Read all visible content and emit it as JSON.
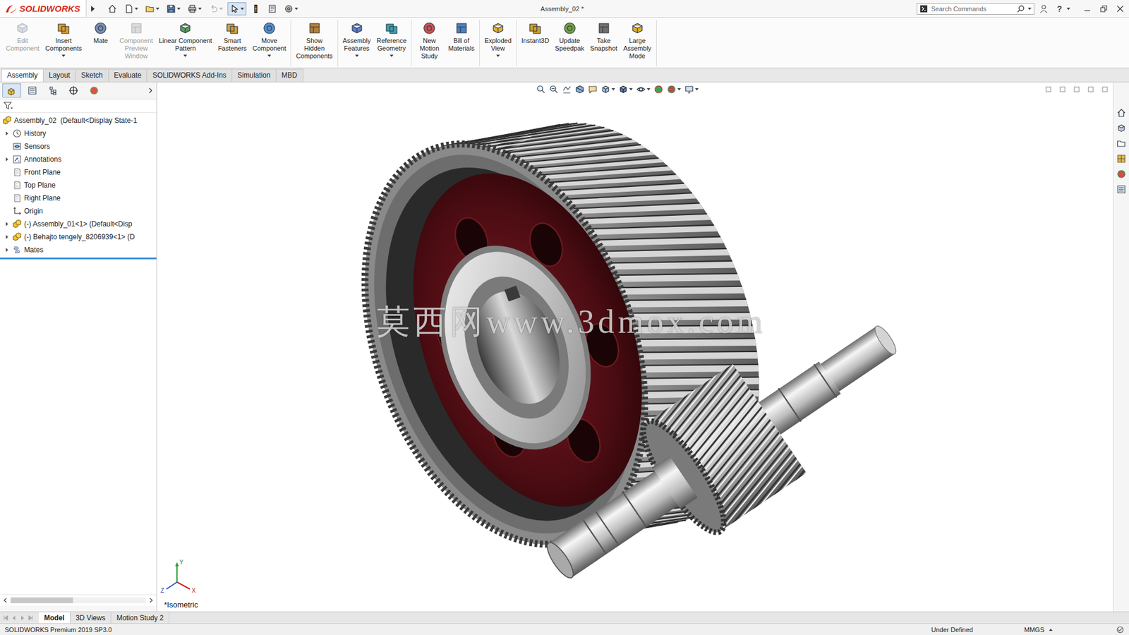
{
  "app": {
    "logo": "SOLIDWORKS",
    "title": "Assembly_02 *",
    "search_placeholder": "Search Commands",
    "help": "?"
  },
  "quick_access": [
    {
      "active": false,
      "disabled": false,
      "dropdown": false
    },
    {
      "active": false,
      "disabled": false,
      "dropdown": true
    },
    {
      "active": false,
      "disabled": false,
      "dropdown": true
    },
    {
      "active": false,
      "disabled": false,
      "dropdown": true
    },
    {
      "active": false,
      "disabled": false,
      "dropdown": true
    },
    {
      "active": false,
      "disabled": true,
      "dropdown": true
    },
    {
      "active": true,
      "disabled": false,
      "dropdown": true
    },
    {
      "active": false,
      "disabled": false,
      "dropdown": false
    },
    {
      "active": false,
      "disabled": false,
      "dropdown": false
    },
    {
      "active": false,
      "disabled": false,
      "dropdown": true
    }
  ],
  "ribbon": {
    "groups": [
      [
        {
          "lines": [
            "Edit",
            "Component"
          ],
          "disabled": true,
          "dropdown": false
        },
        {
          "lines": [
            "Insert",
            "Components"
          ],
          "disabled": false,
          "dropdown": true
        },
        {
          "lines": [
            "Mate"
          ],
          "disabled": false,
          "dropdown": false
        },
        {
          "lines": [
            "Component",
            "Preview",
            "Window"
          ],
          "disabled": true,
          "dropdown": false
        },
        {
          "lines": [
            "Linear Component",
            "Pattern"
          ],
          "disabled": false,
          "dropdown": true
        },
        {
          "lines": [
            "Smart",
            "Fasteners"
          ],
          "disabled": false,
          "dropdown": false
        },
        {
          "lines": [
            "Move",
            "Component"
          ],
          "disabled": false,
          "dropdown": true
        }
      ],
      [
        {
          "lines": [
            "Show",
            "Hidden",
            "Components"
          ],
          "disabled": false,
          "dropdown": false
        }
      ],
      [
        {
          "lines": [
            "Assembly",
            "Features"
          ],
          "disabled": false,
          "dropdown": true
        },
        {
          "lines": [
            "Reference",
            "Geometry"
          ],
          "disabled": false,
          "dropdown": true
        }
      ],
      [
        {
          "lines": [
            "New",
            "Motion",
            "Study"
          ],
          "disabled": false,
          "dropdown": false
        },
        {
          "lines": [
            "Bill of",
            "Materials"
          ],
          "disabled": false,
          "dropdown": false
        }
      ],
      [
        {
          "lines": [
            "Exploded",
            "View"
          ],
          "disabled": false,
          "dropdown": true
        }
      ],
      [
        {
          "lines": [
            "Instant3D"
          ],
          "disabled": false,
          "dropdown": false
        },
        {
          "lines": [
            "Update",
            "Speedpak"
          ],
          "disabled": false,
          "dropdown": false
        },
        {
          "lines": [
            "Take",
            "Snapshot"
          ],
          "disabled": false,
          "dropdown": false
        },
        {
          "lines": [
            "Large",
            "Assembly",
            "Mode"
          ],
          "disabled": false,
          "dropdown": false
        }
      ]
    ]
  },
  "command_tabs": [
    {
      "label": "Assembly",
      "selected": true
    },
    {
      "label": "Layout",
      "selected": false
    },
    {
      "label": "Sketch",
      "selected": false
    },
    {
      "label": "Evaluate",
      "selected": false
    },
    {
      "label": "SOLIDWORKS Add-Ins",
      "selected": false
    },
    {
      "label": "Simulation",
      "selected": false
    },
    {
      "label": "MBD",
      "selected": false
    }
  ],
  "panel_tabs": [
    {
      "selected": true
    },
    {
      "selected": false
    },
    {
      "selected": false
    },
    {
      "selected": false
    },
    {
      "selected": false
    }
  ],
  "feature_tree": {
    "items": [
      {
        "label": "Assembly_02  (Default<Display State-1",
        "kind": "assembly",
        "depth": 0,
        "expandable": false
      },
      {
        "label": "History",
        "kind": "history",
        "depth": 1,
        "expandable": true
      },
      {
        "label": "Sensors",
        "kind": "sensors",
        "depth": 1,
        "expandable": false
      },
      {
        "label": "Annotations",
        "kind": "annotations",
        "depth": 1,
        "expandable": true
      },
      {
        "label": "Front Plane",
        "kind": "plane",
        "depth": 1,
        "expandable": false
      },
      {
        "label": "Top Plane",
        "kind": "plane",
        "depth": 1,
        "expandable": false
      },
      {
        "label": "Right Plane",
        "kind": "plane",
        "depth": 1,
        "expandable": false
      },
      {
        "label": "Origin",
        "kind": "origin",
        "depth": 1,
        "expandable": false
      },
      {
        "label": "(-) Assembly_01<1> (Default<Disp",
        "kind": "assembly",
        "depth": 1,
        "expandable": true
      },
      {
        "label": "(-) Behajto tengely_8206939<1> (D",
        "kind": "assembly",
        "depth": 1,
        "expandable": true
      },
      {
        "label": "Mates",
        "kind": "mates",
        "depth": 1,
        "expandable": true
      }
    ]
  },
  "heads_up": [
    {
      "dropdown": false
    },
    {
      "dropdown": false
    },
    {
      "dropdown": false
    },
    {
      "dropdown": false
    },
    {
      "dropdown": false
    },
    {
      "dropdown": true
    },
    {
      "dropdown": true
    },
    {
      "dropdown": true
    },
    {
      "dropdown": false
    },
    {
      "dropdown": true
    },
    {
      "dropdown": true
    }
  ],
  "view": {
    "orientation": "*Isometric",
    "watermark": "莫西网www.3dmox.com",
    "triad": {
      "x": "X",
      "y": "Y",
      "z": "Z"
    }
  },
  "bottom_tabs": [
    {
      "label": "Model",
      "selected": true
    },
    {
      "label": "3D Views",
      "selected": false
    },
    {
      "label": "Motion Study 2",
      "selected": false
    }
  ],
  "status_bar": {
    "product": "SOLIDWORKS Premium 2019 SP3.0",
    "state": "Under Defined",
    "units": "MMGS"
  }
}
